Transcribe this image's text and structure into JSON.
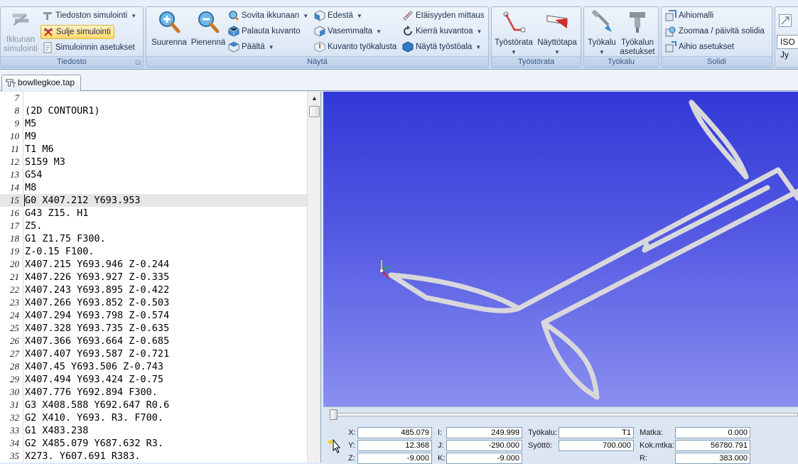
{
  "ribbon": {
    "tiedosto": {
      "label": "Tiedosto",
      "close_window": "Ikkunan\nsimulointi",
      "file_sim": "Tiedoston simulointi",
      "close_sim": "Sulje simulointi",
      "sim_settings": "Simuloinnin asetukset"
    },
    "nayta": {
      "label": "Näytä",
      "zoom_in": "Suurenna",
      "zoom_out": "Pienennä",
      "fit": "Sovita ikkunaan",
      "restore": "Palauta kuvanto",
      "top": "Päältä",
      "front": "Edestä",
      "left": "Vasemmalta",
      "tool_view": "Kuvanto työkalusta",
      "measure": "Etäisyyden mittaus",
      "rotate": "Kierrä kuvantoa",
      "show_plane": "Näytä työstöala"
    },
    "tyostorata": {
      "label": "Työstörata",
      "path": "Työstörata",
      "display": "Näyttötapa"
    },
    "tyokalu": {
      "label": "Työkalu",
      "tool": "Työkalu",
      "tool_settings": "Työkalun\nasetukset"
    },
    "solidi": {
      "label": "Solidi",
      "stock_model": "Aihiomalli",
      "zoom_update": "Zoomaa / päivitä solidia",
      "stock_settings": "Aihio asetukset"
    },
    "extra": {
      "iso": "ISO Jy"
    }
  },
  "document_tab": {
    "name": "bowllegkoe.tap"
  },
  "editor": {
    "lines": [
      {
        "num": "7",
        "text": ""
      },
      {
        "num": "8",
        "text": "(2D CONTOUR1)"
      },
      {
        "num": "9",
        "text": "M5"
      },
      {
        "num": "10",
        "text": "M9"
      },
      {
        "num": "11",
        "text": "T1 M6"
      },
      {
        "num": "12",
        "text": "S159 M3"
      },
      {
        "num": "13",
        "text": "G54"
      },
      {
        "num": "14",
        "text": "M8"
      },
      {
        "num": "15",
        "text": "G0 X407.212 Y693.953"
      },
      {
        "num": "16",
        "text": "G43 Z15. H1"
      },
      {
        "num": "17",
        "text": "Z5."
      },
      {
        "num": "18",
        "text": "G1 Z1.75 F300."
      },
      {
        "num": "19",
        "text": "Z-0.15 F100."
      },
      {
        "num": "20",
        "text": "X407.215 Y693.946 Z-0.244"
      },
      {
        "num": "21",
        "text": "X407.226 Y693.927 Z-0.335"
      },
      {
        "num": "22",
        "text": "X407.243 Y693.895 Z-0.422"
      },
      {
        "num": "23",
        "text": "X407.266 Y693.852 Z-0.503"
      },
      {
        "num": "24",
        "text": "X407.294 Y693.798 Z-0.574"
      },
      {
        "num": "25",
        "text": "X407.328 Y693.735 Z-0.635"
      },
      {
        "num": "26",
        "text": "X407.366 Y693.664 Z-0.685"
      },
      {
        "num": "27",
        "text": "X407.407 Y693.587 Z-0.721"
      },
      {
        "num": "28",
        "text": "X407.45 Y693.506 Z-0.743"
      },
      {
        "num": "29",
        "text": "X407.494 Y693.424 Z-0.75"
      },
      {
        "num": "30",
        "text": "X407.776 Y692.894 F300."
      },
      {
        "num": "31",
        "text": "G3 X408.588 Y692.647 R0.6"
      },
      {
        "num": "32",
        "text": "G2 X410. Y693. R3. F700."
      },
      {
        "num": "33",
        "text": "G1 X483.238"
      },
      {
        "num": "34",
        "text": "G2 X485.079 Y687.632 R3."
      },
      {
        "num": "35",
        "text": "X273. Y607.691 R383."
      }
    ],
    "current_line": "15"
  },
  "status": {
    "x_label": "X:",
    "x_value": "485.079",
    "y_label": "Y:",
    "y_value": "12.368",
    "z_label": "Z:",
    "z_value": "-9.000",
    "i_label": "I:",
    "i_value": "249.999",
    "j_label": "J:",
    "j_value": "-290.000",
    "k_label": "K:",
    "k_value": "-9.000",
    "tool_label": "Työkalu:",
    "tool_value": "T1",
    "feed_label": "Syöttö:",
    "feed_value": "700.000",
    "dist_label": "Matka:",
    "dist_value": "0.000",
    "total_label": "Kok.mtka:",
    "total_value": "56780.791",
    "r_label": "R:",
    "r_value": "383.000"
  },
  "colors": {
    "viewport_top": "#3238d6",
    "viewport_bottom": "#8a8ff0",
    "toolpath": "#d8d8dc",
    "current_line_bg": "#e6e6e6"
  }
}
